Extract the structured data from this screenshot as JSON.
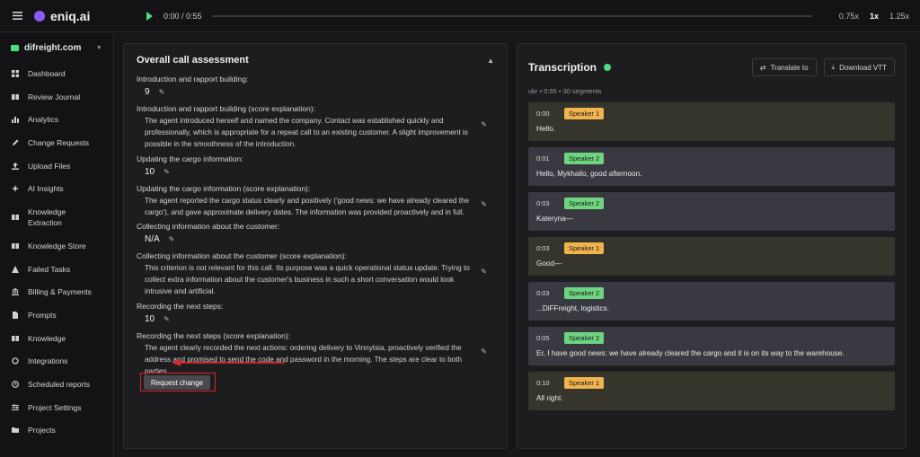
{
  "app": {
    "name": "eniq.ai"
  },
  "player": {
    "time": "0:00 / 0:55",
    "speeds": [
      "0.75x",
      "1x",
      "1.25x"
    ],
    "active_speed": "1x",
    "progress": 0
  },
  "sidebar": {
    "workspace": "difreight.com",
    "items": [
      {
        "label": "Dashboard",
        "icon": "grid-icon"
      },
      {
        "label": "Review Journal",
        "icon": "book-icon"
      },
      {
        "label": "Analytics",
        "icon": "bar-chart-icon"
      },
      {
        "label": "Change Requests",
        "icon": "pencil-icon"
      },
      {
        "label": "Upload Files",
        "icon": "upload-icon"
      },
      {
        "label": "AI Insights",
        "icon": "sparkle-icon"
      },
      {
        "label": "Knowledge Extraction",
        "icon": "book-icon"
      },
      {
        "label": "Knowledge Store",
        "icon": "book-icon"
      },
      {
        "label": "Failed Tasks",
        "icon": "warning-icon"
      },
      {
        "label": "Billing & Payments",
        "icon": "bank-icon"
      },
      {
        "label": "Prompts",
        "icon": "document-icon"
      },
      {
        "label": "Knowledge",
        "icon": "book-icon"
      },
      {
        "label": "Integrations",
        "icon": "refresh-icon"
      },
      {
        "label": "Scheduled reports",
        "icon": "clock-icon"
      },
      {
        "label": "Project Settings",
        "icon": "settings-icon"
      },
      {
        "label": "Projects",
        "icon": "folder-icon"
      }
    ]
  },
  "assessment": {
    "title": "Overall call assessment",
    "fields": [
      {
        "label": "Introduction and rapport building:",
        "value": "9",
        "explain_label": "Introduction and rapport building (score explanation):",
        "explain": "The agent introduced herself and named the company. Contact was established quickly and professionally, which is appropriate for a repeat call to an existing customer. A slight improvement is possible in the smoothness of the introduction."
      },
      {
        "label": "Updating the cargo information:",
        "value": "10",
        "explain_label": "Updating the cargo information (score explanation):",
        "explain": "The agent reported the cargo status clearly and positively ('good news: we have already cleared the cargo'), and gave approximate delivery dates. The information was provided proactively and in full."
      },
      {
        "label": "Collecting information about the customer:",
        "value": "N/A",
        "explain_label": "Collecting information about the customer (score explanation):",
        "explain": "This criterion is not relevant for this call. Its purpose was a quick operational status update. Trying to collect extra information about the customer's business in such a short conversation would look intrusive and artificial."
      },
      {
        "label": "Recording the next steps:",
        "value": "10",
        "explain_label": "Recording the next steps (score explanation):",
        "explain": "The agent clearly recorded the next actions: ordering delivery to Vinnytsia, proactively verified the address and promised to send the code and password in the morning. The steps are clear to both parties."
      }
    ],
    "tooltip": "Request change"
  },
  "transcription": {
    "title": "Transcription",
    "translate_label": "Translate to",
    "download_label": "Download VTT",
    "meta": "ukr • 0:55 • 30 segments",
    "segments": [
      {
        "time": "0:00",
        "speaker": "Speaker 1",
        "text": "Hello."
      },
      {
        "time": "0:01",
        "speaker": "Speaker 2",
        "text": "Hello, Mykhailo, good afternoon."
      },
      {
        "time": "0:03",
        "speaker": "Speaker 2",
        "text": "Kateryna—"
      },
      {
        "time": "0:03",
        "speaker": "Speaker 1",
        "text": "Good—"
      },
      {
        "time": "0:03",
        "speaker": "Speaker 2",
        "text": "...DiFFreight, logistics."
      },
      {
        "time": "0:05",
        "speaker": "Speaker 2",
        "text": "Er, I have good news: we have already cleared the cargo and it is on its way to the warehouse."
      },
      {
        "time": "0:10",
        "speaker": "Speaker 1",
        "text": "All right."
      }
    ]
  },
  "colors": {
    "accent": "#4ade80",
    "speaker1": "#f0b34e",
    "speaker2": "#6fd47f",
    "arrow": "#e02424"
  }
}
